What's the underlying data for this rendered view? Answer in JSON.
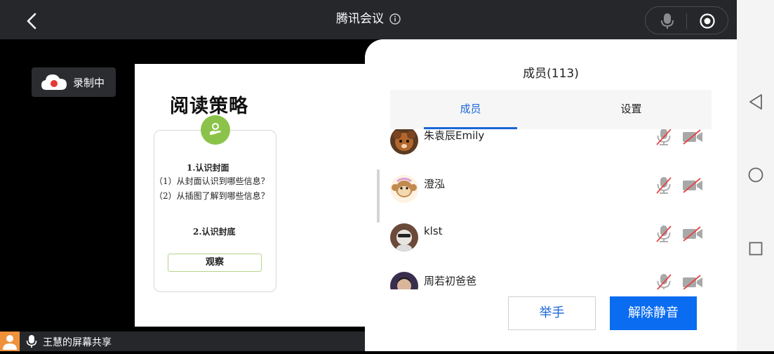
{
  "header": {
    "title": "腾讯会议",
    "back_icon": "chevron-left-icon",
    "info_icon": "info-icon",
    "mic_icon": "microphone-icon",
    "record_icon": "record-icon"
  },
  "recording_badge": {
    "label": "录制中",
    "icon": "cloud-record-icon"
  },
  "slide": {
    "title": "阅读策略",
    "section1": "1.认识封面",
    "line1": "（1）从封面认识到哪些信息？",
    "line2": "（2）从插图了解到哪些信息？",
    "section2": "2.认识封底",
    "button": "观察",
    "badge_color": "#8bc34a"
  },
  "share_bar": {
    "label": "王慧的屏幕共享"
  },
  "panel": {
    "title": "成员(113)",
    "tabs": [
      {
        "label": "成员",
        "active": true
      },
      {
        "label": "设置",
        "active": false
      }
    ],
    "members": [
      {
        "name": "朱袁辰Emily",
        "mic": "muted",
        "camera": "off"
      },
      {
        "name": "澄泓",
        "mic": "muted",
        "camera": "off"
      },
      {
        "name": "klst",
        "mic": "muted",
        "camera": "off"
      },
      {
        "name": "周若初爸爸",
        "mic": "muted",
        "camera": "off"
      }
    ],
    "raise_hand": "举手",
    "unmute": "解除静音"
  },
  "colors": {
    "accent": "#1a66d8",
    "primary_button": "#0a6cf0",
    "muted_red": "#e54545"
  }
}
